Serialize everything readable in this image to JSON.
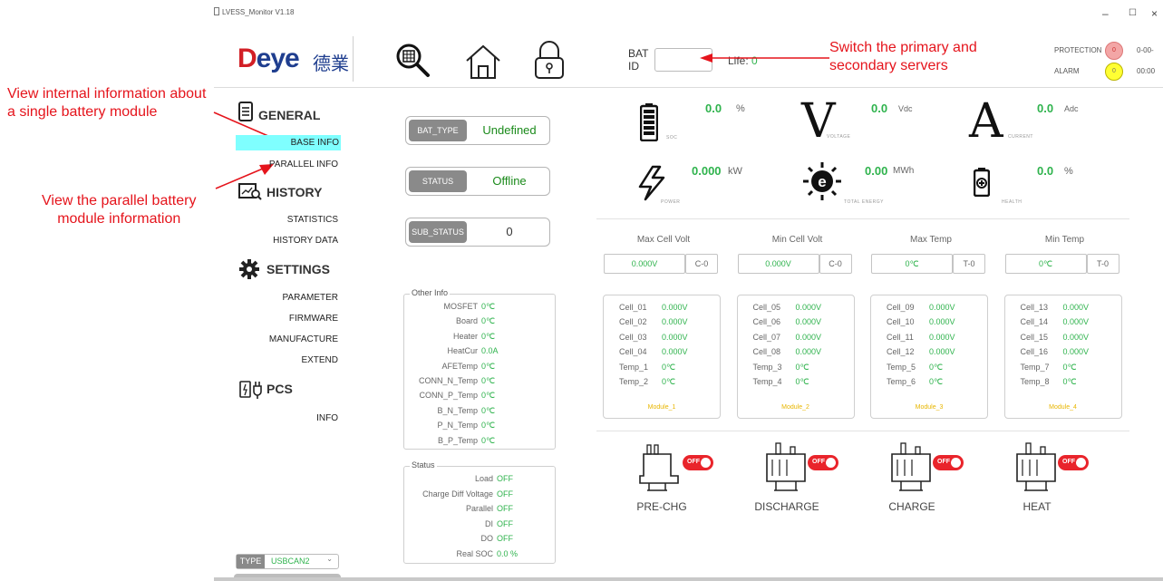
{
  "window": {
    "title": "LVESS_Monitor V1.18",
    "min": "–",
    "max": "☐",
    "close": "×"
  },
  "brand": {
    "logo": "Deye",
    "logo_cn": "德業"
  },
  "toolbar": {
    "icons": [
      "battery-search-icon",
      "home-icon",
      "lock-icon"
    ],
    "bat_id_label_1": "BAT",
    "bat_id_label_2": "ID",
    "bat_id_value": "",
    "life_label": "Life:",
    "life_value": "0"
  },
  "alarms": {
    "protection_label": "PROTECTION",
    "protection_count": "0",
    "protection_code": "0-00-",
    "alarm_label": "ALARM",
    "alarm_count": "0",
    "alarm_code": "00:00"
  },
  "annotations": {
    "switch_servers": "Switch the primary and\nsecondary servers",
    "base_info": "View internal information about\na single battery module",
    "parallel_info": "View the parallel battery\nmodule information"
  },
  "sidebar": {
    "general": "GENERAL",
    "base_info": "BASE INFO",
    "parallel_info": "PARALLEL INFO",
    "history": "HISTORY",
    "statistics": "STATISTICS",
    "history_data": "HISTORY DATA",
    "settings": "SETTINGS",
    "parameter": "PARAMETER",
    "firmware": "FIRMWARE",
    "manufacture": "MANUFACTURE",
    "extend": "EXTEND",
    "pcs": "PCS",
    "info": "INFO",
    "type_label": "TYPE",
    "type_value": "USBCAN2"
  },
  "pills": {
    "bat_type_label": "BAT_TYPE",
    "bat_type_value": "Undefined",
    "status_label": "STATUS",
    "status_value": "Offline",
    "sub_status_label": "SUB_STATUS",
    "sub_status_value": "0"
  },
  "other_info": {
    "title": "Other Info",
    "rows": [
      {
        "k": "MOSFET",
        "v": "0℃"
      },
      {
        "k": "Board",
        "v": "0℃"
      },
      {
        "k": "Heater",
        "v": "0℃"
      },
      {
        "k": "HeatCur",
        "v": "0.0A"
      },
      {
        "k": "AFETemp",
        "v": "0℃"
      },
      {
        "k": "CONN_N_Temp",
        "v": "0℃"
      },
      {
        "k": "CONN_P_Temp",
        "v": "0℃"
      },
      {
        "k": "B_N_Temp",
        "v": "0℃"
      },
      {
        "k": "P_N_Temp",
        "v": "0℃"
      },
      {
        "k": "B_P_Temp",
        "v": "0℃"
      }
    ]
  },
  "status_info": {
    "title": "Status",
    "rows": [
      {
        "k": "Load",
        "v": "OFF"
      },
      {
        "k": "Charge Diff Voltage",
        "v": "OFF"
      },
      {
        "k": "Parallel",
        "v": "OFF"
      },
      {
        "k": "DI",
        "v": "OFF"
      },
      {
        "k": "DO",
        "v": "OFF"
      },
      {
        "k": "Real SOC",
        "v": "0.0 %"
      }
    ]
  },
  "metrics": {
    "soc": {
      "value": "0.0",
      "unit": "%",
      "tag": "SOC"
    },
    "voltage": {
      "value": "0.0",
      "unit": "Vdc",
      "tag": "VOLTAGE",
      "glyph": "V"
    },
    "current": {
      "value": "0.0",
      "unit": "Adc",
      "tag": "CURRENT",
      "glyph": "A"
    },
    "power": {
      "value": "0.000",
      "unit": "kW",
      "tag": "POWER"
    },
    "total_energy": {
      "value": "0.00",
      "unit": "MWh",
      "tag": "TOTAL ENERGY"
    },
    "health": {
      "value": "0.0",
      "unit": "%",
      "tag": "HEALTH"
    }
  },
  "minmax": [
    {
      "title": "Max Cell Volt",
      "value": "0.000V",
      "id": "C-0"
    },
    {
      "title": "Min Cell Volt",
      "value": "0.000V",
      "id": "C-0"
    },
    {
      "title": "Max Temp",
      "value": "0℃",
      "id": "T-0"
    },
    {
      "title": "Min Temp",
      "value": "0℃",
      "id": "T-0"
    }
  ],
  "modules": [
    {
      "name": "Module_1",
      "rows": [
        [
          "Cell_01",
          "0.000V"
        ],
        [
          "Cell_02",
          "0.000V"
        ],
        [
          "Cell_03",
          "0.000V"
        ],
        [
          "Cell_04",
          "0.000V"
        ],
        [
          "Temp_1",
          "0℃"
        ],
        [
          "Temp_2",
          "0℃"
        ]
      ]
    },
    {
      "name": "Module_2",
      "rows": [
        [
          "Cell_05",
          "0.000V"
        ],
        [
          "Cell_06",
          "0.000V"
        ],
        [
          "Cell_07",
          "0.000V"
        ],
        [
          "Cell_08",
          "0.000V"
        ],
        [
          "Temp_3",
          "0℃"
        ],
        [
          "Temp_4",
          "0℃"
        ]
      ]
    },
    {
      "name": "Module_3",
      "rows": [
        [
          "Cell_09",
          "0.000V"
        ],
        [
          "Cell_10",
          "0.000V"
        ],
        [
          "Cell_11",
          "0.000V"
        ],
        [
          "Cell_12",
          "0.000V"
        ],
        [
          "Temp_5",
          "0℃"
        ],
        [
          "Temp_6",
          "0℃"
        ]
      ]
    },
    {
      "name": "Module_4",
      "rows": [
        [
          "Cell_13",
          "0.000V"
        ],
        [
          "Cell_14",
          "0.000V"
        ],
        [
          "Cell_15",
          "0.000V"
        ],
        [
          "Cell_16",
          "0.000V"
        ],
        [
          "Temp_7",
          "0℃"
        ],
        [
          "Temp_8",
          "0℃"
        ]
      ]
    }
  ],
  "relays": [
    {
      "label": "PRE-CHG",
      "state": "OFF"
    },
    {
      "label": "DISCHARGE",
      "state": "OFF"
    },
    {
      "label": "CHARGE",
      "state": "OFF"
    },
    {
      "label": "HEAT",
      "state": "OFF"
    }
  ],
  "colors": {
    "value_green": "#2fb34d",
    "annotation_red": "#e5141c",
    "switch_red": "#e9242b",
    "selected_cyan": "#7fffff"
  }
}
